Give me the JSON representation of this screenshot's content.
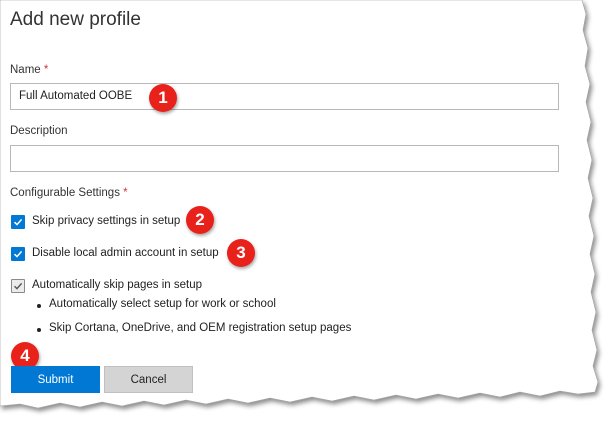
{
  "form": {
    "title": "Add new profile",
    "name_label": "Name",
    "name_value": "Full Automated OOBE",
    "description_label": "Description",
    "description_value": "",
    "settings_label": "Configurable Settings",
    "required_mark": "*",
    "options": [
      {
        "label": "Skip privacy settings in setup",
        "checked": true
      },
      {
        "label": "Disable local admin account in setup",
        "checked": true
      },
      {
        "label": "Automatically skip pages in setup",
        "checked": "partial"
      }
    ],
    "sub_items": [
      "Automatically select setup for work or school",
      "Skip Cortana, OneDrive, and OEM registration setup pages"
    ],
    "submit_label": "Submit",
    "cancel_label": "Cancel"
  },
  "callouts": [
    "1",
    "2",
    "3",
    "4"
  ],
  "colors": {
    "accent": "#0078d4",
    "callout": "#e8221b",
    "required": "#d13438"
  }
}
